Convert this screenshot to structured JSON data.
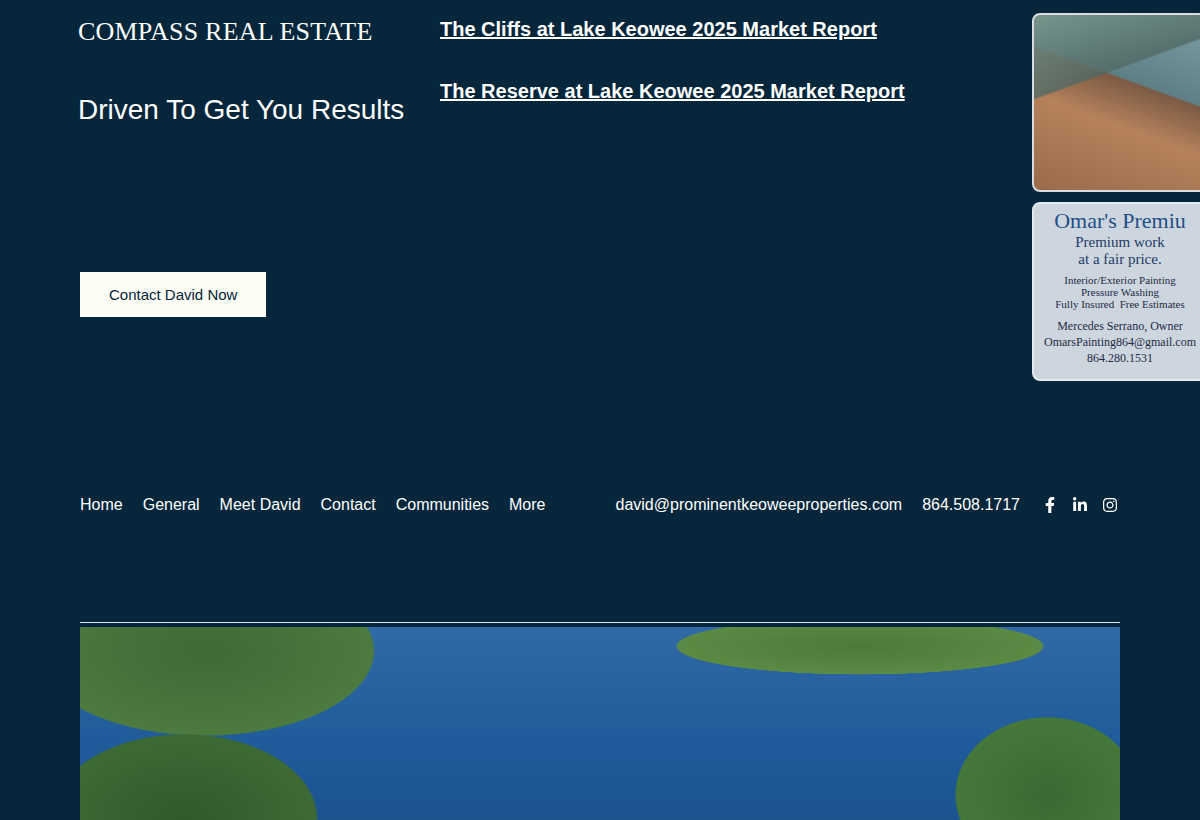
{
  "header": {
    "logo": "COMPASS REAL ESTATE",
    "tagline": "Driven To Get You Results",
    "cta": "Contact David Now"
  },
  "reports": [
    {
      "label": "The Cliffs at Lake Keowee 2025 Market Report"
    },
    {
      "label": "The Reserve at Lake Keowee 2025 Market Report"
    }
  ],
  "sidebar_ads": [
    {
      "kind": "photo"
    },
    {
      "kind": "flyer",
      "title": "Omar's Premiu",
      "slogan": [
        "Premium work",
        "at a fair price."
      ],
      "services": [
        "Interior/Exterior Painting",
        "Pressure Washing",
        "Fully Insured  Free Estimates"
      ],
      "owner": "Mercedes Serrano, Owner",
      "email": "OmarsPainting864@gmail.com",
      "phone": "864.280.1531"
    }
  ],
  "nav": {
    "items": [
      "Home",
      "General",
      "Meet David",
      "Contact",
      "Communities",
      "More"
    ]
  },
  "contact": {
    "email": "david@prominentkeoweeproperties.com",
    "phone": "864.508.1717"
  }
}
